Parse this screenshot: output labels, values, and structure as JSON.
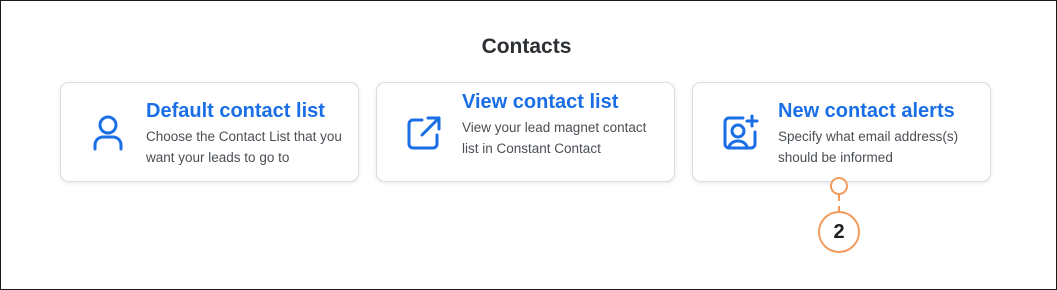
{
  "page": {
    "title": "Contacts"
  },
  "colors": {
    "accent": "#1a6ee6",
    "callout": "#f39b5c"
  },
  "cards": [
    {
      "icon": "user-icon",
      "title": "Default contact list",
      "description": "Choose the Contact List that you want your leads to go to"
    },
    {
      "icon": "external-link-icon",
      "title": "View contact list",
      "description": "View your lead magnet contact list in Constant Contact"
    },
    {
      "icon": "add-contact-icon",
      "title": "New contact alerts",
      "description": "Specify what email address(s) should be informed"
    }
  ],
  "callout": {
    "number": "2"
  }
}
